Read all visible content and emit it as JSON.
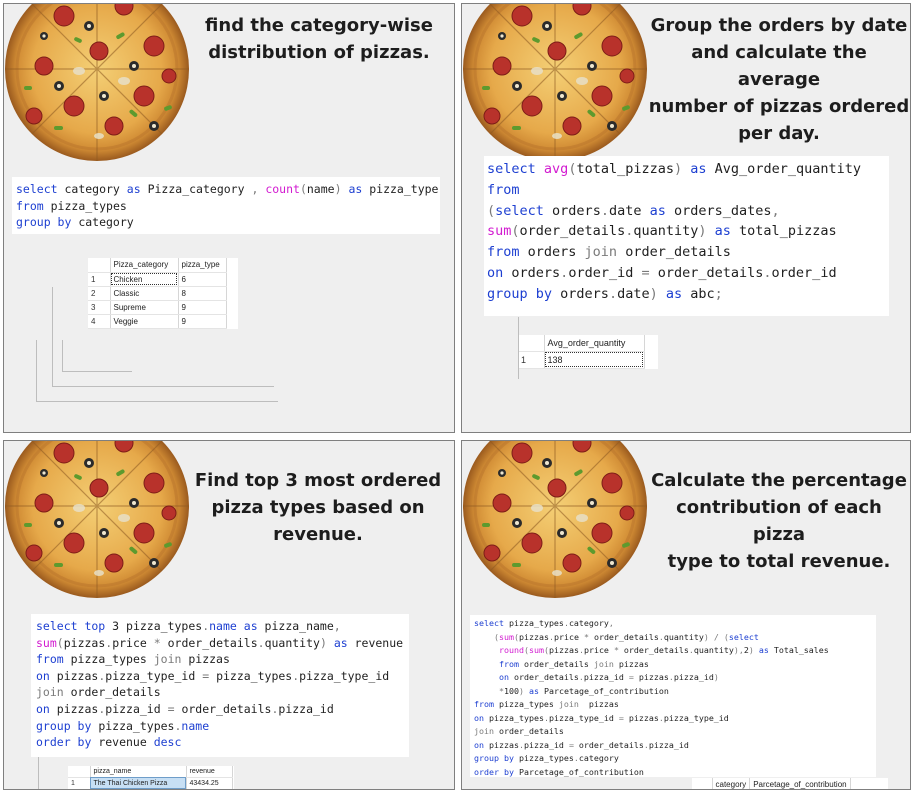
{
  "panels": [
    {
      "title": "find the category-wise distribution of pizzas.",
      "title_lines": [
        "find the category-wise",
        "distribution of pizzas."
      ],
      "result": {
        "columns": [
          "Pizza_category",
          "pizza_type"
        ],
        "rows": [
          {
            "n": "1",
            "c1": "Chicken",
            "c2": "6"
          },
          {
            "n": "2",
            "c1": "Classic",
            "c2": "8"
          },
          {
            "n": "3",
            "c1": "Supreme",
            "c2": "9"
          },
          {
            "n": "4",
            "c1": "Veggie",
            "c2": "9"
          }
        ]
      }
    },
    {
      "title": "Group the orders by date and calculate the average number of pizzas ordered per day.",
      "title_lines": [
        "Group the orders by date",
        "and calculate the average",
        "number of pizzas ordered",
        "per day."
      ],
      "result": {
        "columns": [
          "Avg_order_quantity"
        ],
        "rows": [
          {
            "n": "1",
            "c1": "138"
          }
        ]
      }
    },
    {
      "title": "Find top 3 most ordered pizza types based on revenue.",
      "title_lines": [
        "Find top 3 most ordered",
        "pizza types based on",
        "revenue."
      ],
      "result": {
        "columns": [
          "pizza_name",
          "revenue"
        ],
        "rows": [
          {
            "n": "1",
            "c1": "The Thai Chicken Pizza",
            "c2": "43434.25"
          }
        ]
      }
    },
    {
      "title": "Calculate the percentage contribution of each pizza type to total revenue.",
      "title_lines": [
        "Calculate the percentage",
        "contribution of each pizza",
        "type to total revenue."
      ],
      "result": {
        "columns": [
          "category",
          "Parcetage_of_contribution"
        ]
      }
    }
  ],
  "colors": {
    "keyword": "#1d3fd1",
    "function": "#d21bd0",
    "operator": "#7a7a7a",
    "panel_bg": "#efefef",
    "selection": "#c7dff4"
  }
}
